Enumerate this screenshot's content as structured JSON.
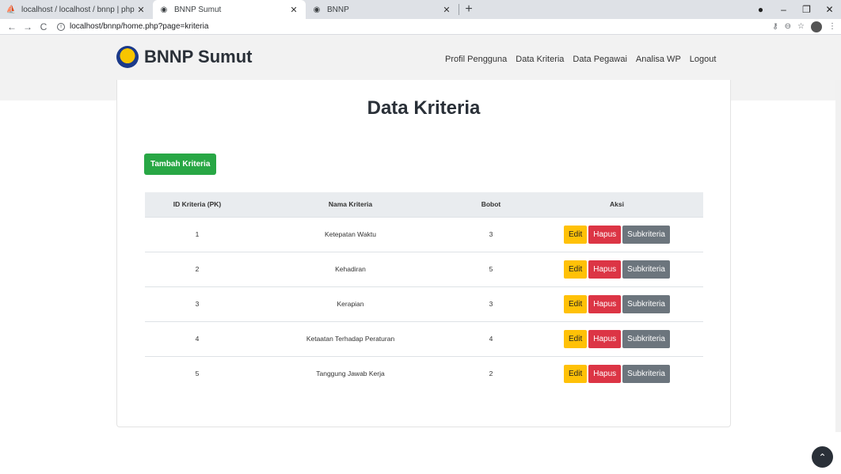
{
  "browser": {
    "tabs": [
      {
        "title": "localhost / localhost / bnnp | php",
        "icon": "phpmyadmin-icon"
      },
      {
        "title": "BNNP Sumut",
        "icon": "globe-icon"
      },
      {
        "title": "BNNP",
        "icon": "globe-icon"
      }
    ],
    "url": "localhost/bnnp/home.php?page=kriteria"
  },
  "site": {
    "brand": "BNNP Sumut",
    "menu": [
      "Profil Pengguna",
      "Data Kriteria",
      "Data Pegawai",
      "Analisa WP",
      "Logout"
    ]
  },
  "main": {
    "heading": "Data Kriteria",
    "add_button": "Tambah Kriteria",
    "columns": [
      "ID Kriteria (PK)",
      "Nama Kriteria",
      "Bobot",
      "Aksi"
    ],
    "rows": [
      {
        "id": "1",
        "nama": "Ketepatan Waktu",
        "bobot": "3"
      },
      {
        "id": "2",
        "nama": "Kehadiran",
        "bobot": "5"
      },
      {
        "id": "3",
        "nama": "Kerapian",
        "bobot": "3"
      },
      {
        "id": "4",
        "nama": "Ketaatan Terhadap Peraturan",
        "bobot": "4"
      },
      {
        "id": "5",
        "nama": "Tanggung Jawab Kerja",
        "bobot": "2"
      }
    ],
    "actions": {
      "edit": "Edit",
      "hapus": "Hapus",
      "sub": "Subkriteria"
    }
  },
  "colors": {
    "success": "#28a745",
    "warning": "#ffc107",
    "danger": "#dc3545",
    "secondary": "#6c757d"
  }
}
